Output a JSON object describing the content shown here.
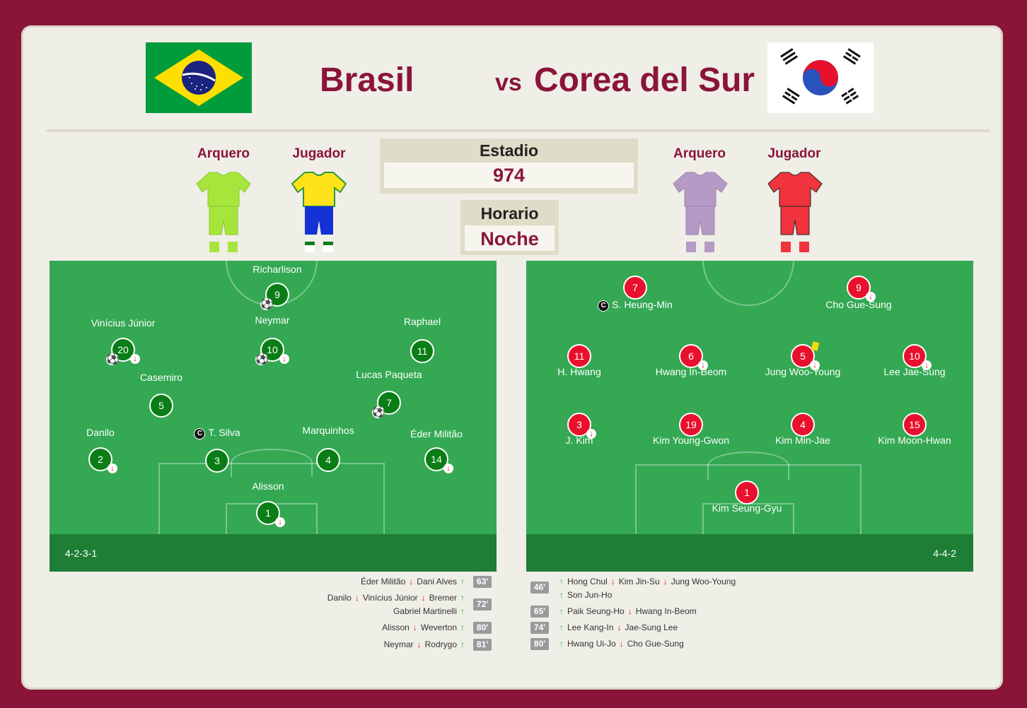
{
  "colors": {
    "maroon": "#8a1538",
    "home_circle": "#0a7d16",
    "away_circle": "#e8112d",
    "pitch": "#34a853"
  },
  "match": {
    "home": "Brasil",
    "vs": "vs",
    "away": "Corea del Sur"
  },
  "kits": {
    "home": {
      "gk_label": "Arquero",
      "player_label": "Jugador",
      "gk_icon": "gk-kit-icon",
      "player_icon": "player-kit-icon"
    },
    "away": {
      "gk_label": "Arquero",
      "player_label": "Jugador",
      "gk_icon": "gk-kit-icon",
      "player_icon": "player-kit-icon"
    }
  },
  "info": {
    "stadium_label": "Estadio",
    "stadium": "974",
    "time_label": "Horario",
    "time": "Noche"
  },
  "home": {
    "formation": "4-2-3-1",
    "players": [
      {
        "num": "9",
        "name": "Richarlison",
        "goal": true,
        "subbed": false,
        "captain": false
      },
      {
        "num": "20",
        "name": "Vinícius Júnior",
        "goal": true,
        "subbed": true,
        "captain": false
      },
      {
        "num": "10",
        "name": "Neymar",
        "goal": true,
        "subbed": true,
        "captain": false
      },
      {
        "num": "11",
        "name": "Raphael",
        "goal": false,
        "subbed": false,
        "captain": false
      },
      {
        "num": "5",
        "name": "Casemiro",
        "goal": false,
        "subbed": false,
        "captain": false
      },
      {
        "num": "7",
        "name": "Lucas Paqueta",
        "goal": true,
        "subbed": false,
        "captain": false
      },
      {
        "num": "2",
        "name": "Danilo",
        "goal": false,
        "subbed": true,
        "captain": false
      },
      {
        "num": "3",
        "name": "T. Silva",
        "goal": false,
        "subbed": false,
        "captain": true
      },
      {
        "num": "4",
        "name": "Marquinhos",
        "goal": false,
        "subbed": false,
        "captain": false
      },
      {
        "num": "14",
        "name": "Éder Militão",
        "goal": false,
        "subbed": true,
        "captain": false
      },
      {
        "num": "1",
        "name": "Alisson",
        "goal": false,
        "subbed": true,
        "captain": false
      }
    ],
    "subs": [
      {
        "out": "Éder Militão",
        "in": "Dani Alves",
        "min": "63'"
      },
      {
        "out": "Danilo",
        "out2": "Vinícius Júnior",
        "in": "Bremer",
        "in2": "Gabriel Martinelli",
        "min": "72'"
      },
      {
        "out": "Alisson",
        "in": "Weverton",
        "min": "80'"
      },
      {
        "out": "Neymar",
        "in": "Rodrygo",
        "min": "81'"
      }
    ]
  },
  "away": {
    "formation": "4-4-2",
    "players": [
      {
        "num": "7",
        "name": "S. Heung-Min",
        "goal": false,
        "subbed": false,
        "captain": true,
        "yellow": false
      },
      {
        "num": "9",
        "name": "Cho Gue-Sung",
        "goal": false,
        "subbed": true,
        "captain": false,
        "yellow": false
      },
      {
        "num": "11",
        "name": "H. Hwang",
        "goal": false,
        "subbed": false,
        "captain": false,
        "yellow": false
      },
      {
        "num": "6",
        "name": "Hwang In-Beom",
        "goal": false,
        "subbed": true,
        "captain": false,
        "yellow": false
      },
      {
        "num": "5",
        "name": "Jung Woo-Young",
        "goal": false,
        "subbed": true,
        "captain": false,
        "yellow": true
      },
      {
        "num": "10",
        "name": "Lee Jae-Sung",
        "goal": false,
        "subbed": true,
        "captain": false,
        "yellow": false
      },
      {
        "num": "3",
        "name": "J. Kim",
        "goal": false,
        "subbed": true,
        "captain": false,
        "yellow": false
      },
      {
        "num": "19",
        "name": "Kim Young-Gwon",
        "goal": false,
        "subbed": false,
        "captain": false,
        "yellow": false
      },
      {
        "num": "4",
        "name": "Kim Min-Jae",
        "goal": false,
        "subbed": false,
        "captain": false,
        "yellow": false
      },
      {
        "num": "15",
        "name": "Kim Moon-Hwan",
        "goal": false,
        "subbed": false,
        "captain": false,
        "yellow": false
      },
      {
        "num": "1",
        "name": "Kim Seung-Gyu",
        "goal": false,
        "subbed": false,
        "captain": false,
        "yellow": false
      }
    ],
    "subs": [
      {
        "min": "46'",
        "in": "Hong Chul",
        "out": "Kim Jin-Su",
        "out2": "Jung Woo-Young",
        "in2": "Son Jun-Ho"
      },
      {
        "min": "65'",
        "in": "Paik Seung-Ho",
        "out": "Hwang In-Beom"
      },
      {
        "min": "74'",
        "in": "Lee Kang-In",
        "out": "Jae-Sung Lee"
      },
      {
        "min": "80'",
        "in": "Hwang Ui-Jo",
        "out": "Cho Gue-Sung"
      }
    ]
  }
}
